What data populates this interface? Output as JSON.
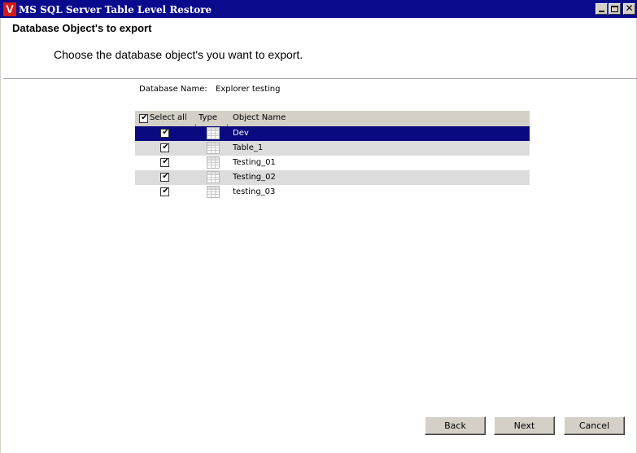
{
  "window": {
    "title": "MS SQL Server Table Level Restore",
    "logo_letter": "V",
    "controls": {
      "minimize": "",
      "maximize": "",
      "close": "✕"
    }
  },
  "header": {
    "title": "Database Object's to export",
    "subtitle": "Choose the database object's you want to export."
  },
  "database": {
    "label": "Database Name:",
    "value": "Explorer testing"
  },
  "grid": {
    "columns": {
      "select_all": "Select all",
      "type": "Type",
      "object_name": "Object Name"
    },
    "select_all_checked": true,
    "rows": [
      {
        "name": "Dev",
        "checked": true,
        "type_icon": "table-icon",
        "selected": true
      },
      {
        "name": "Table_1",
        "checked": true,
        "type_icon": "table-icon",
        "selected": false
      },
      {
        "name": "Testing_01",
        "checked": true,
        "type_icon": "table-icon",
        "selected": false
      },
      {
        "name": "Testing_02",
        "checked": true,
        "type_icon": "table-icon",
        "selected": false
      },
      {
        "name": "testing_03",
        "checked": true,
        "type_icon": "table-icon",
        "selected": false
      }
    ]
  },
  "buttons": {
    "back": "Back",
    "next": "Next",
    "cancel": "Cancel"
  },
  "colors": {
    "titlebar": "#0a0a8c",
    "selection": "#0a0a80",
    "alt_row": "#dcdcdc",
    "button_face": "#d4d0c8",
    "logo": "#d21a1a"
  }
}
